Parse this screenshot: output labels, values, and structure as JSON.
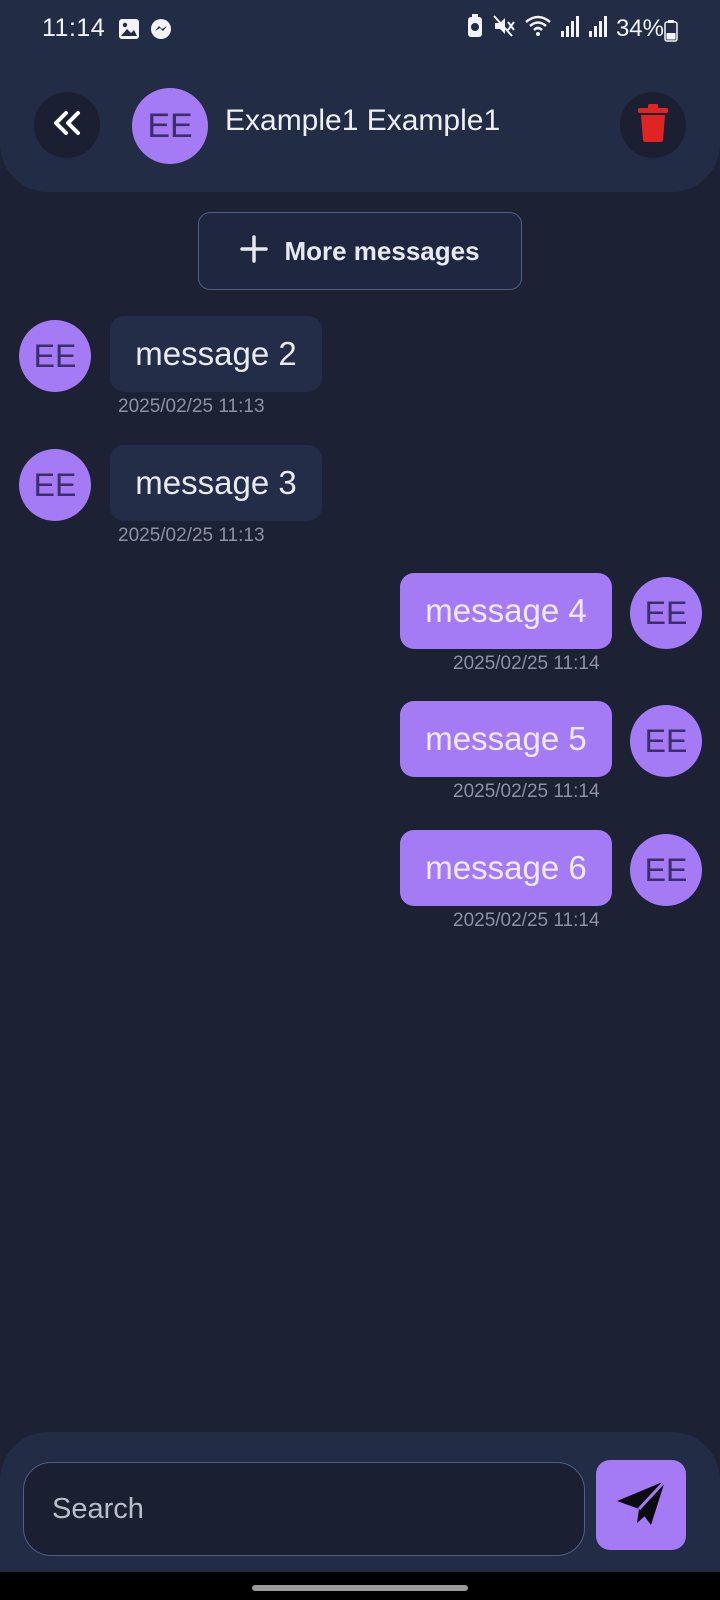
{
  "status_bar": {
    "time": "11:14",
    "battery_pct": "34%",
    "icons": [
      "image-icon",
      "messenger-icon",
      "battery-saver-icon",
      "mute-icon",
      "wifi-icon",
      "signal-icon",
      "signal-icon",
      "battery-icon"
    ]
  },
  "header": {
    "avatar_initials": "EE",
    "title": "Example1 Example1",
    "back_icon": "double-chevron-left-icon",
    "delete_icon": "trash-icon"
  },
  "more_messages": {
    "label": "More messages",
    "icon": "plus-icon"
  },
  "messages": [
    {
      "text": "message 2",
      "timestamp": "2025/02/25 11:13",
      "direction": "incoming",
      "avatar": "EE"
    },
    {
      "text": "message 3",
      "timestamp": "2025/02/25 11:13",
      "direction": "incoming",
      "avatar": "EE"
    },
    {
      "text": "message 4",
      "timestamp": "2025/02/25 11:14",
      "direction": "outgoing",
      "avatar": "EE"
    },
    {
      "text": "message 5",
      "timestamp": "2025/02/25 11:14",
      "direction": "outgoing",
      "avatar": "EE"
    },
    {
      "text": "message 6",
      "timestamp": "2025/02/25 11:14",
      "direction": "outgoing",
      "avatar": "EE"
    }
  ],
  "composer": {
    "placeholder": "Search",
    "value": "",
    "send_icon": "send-icon"
  },
  "colors": {
    "background": "#1c2133",
    "panel": "#222c44",
    "accent": "#a47bf5",
    "delete": "#e02424"
  }
}
